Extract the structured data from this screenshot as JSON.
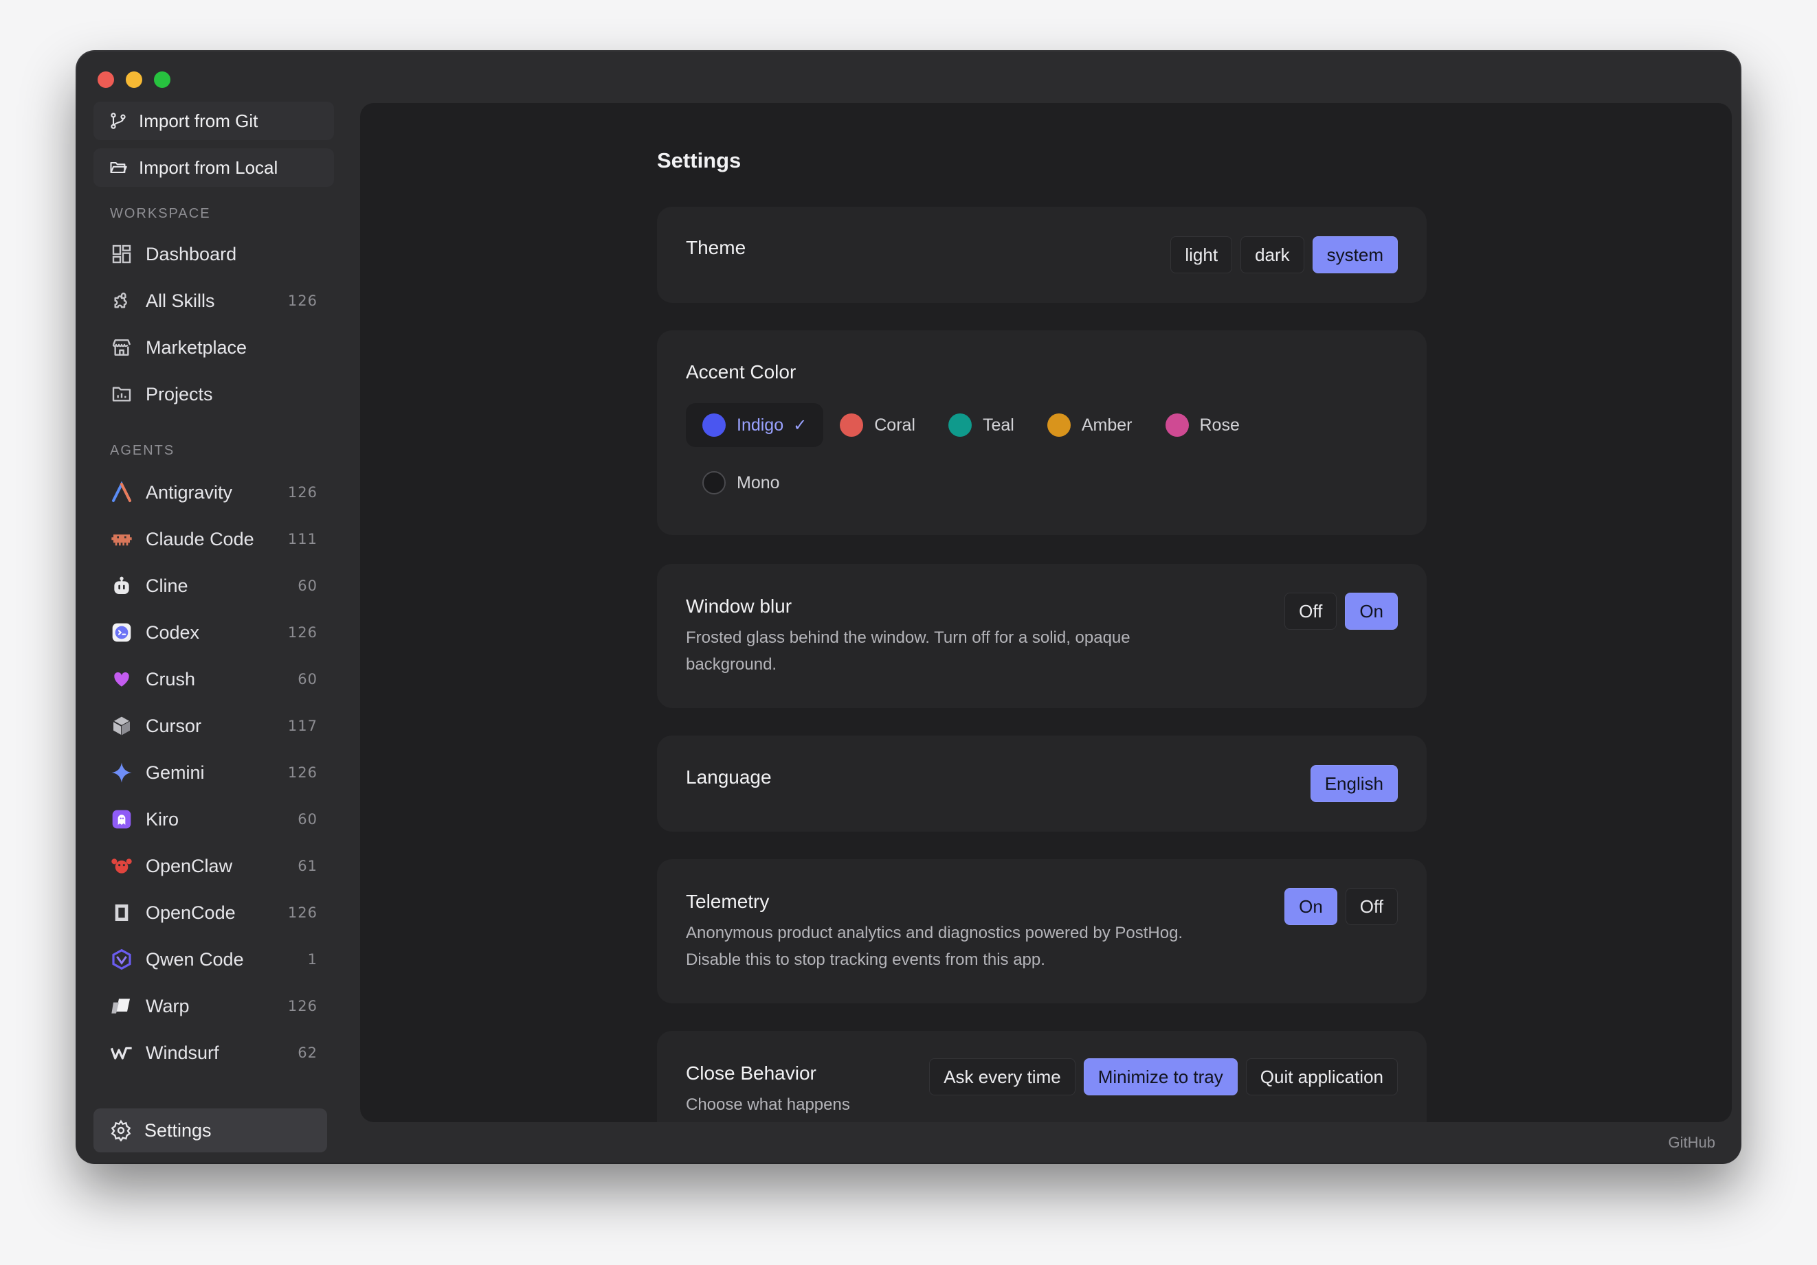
{
  "sidebar": {
    "import_git": "Import from Git",
    "import_local": "Import from Local",
    "workspace_label": "WORKSPACE",
    "workspace": [
      {
        "label": "Dashboard",
        "count": ""
      },
      {
        "label": "All Skills",
        "count": "126"
      },
      {
        "label": "Marketplace",
        "count": ""
      },
      {
        "label": "Projects",
        "count": ""
      }
    ],
    "agents_label": "AGENTS",
    "agents": [
      {
        "label": "Antigravity",
        "count": "126"
      },
      {
        "label": "Claude Code",
        "count": "111"
      },
      {
        "label": "Cline",
        "count": "60"
      },
      {
        "label": "Codex",
        "count": "126"
      },
      {
        "label": "Crush",
        "count": "60"
      },
      {
        "label": "Cursor",
        "count": "117"
      },
      {
        "label": "Gemini",
        "count": "126"
      },
      {
        "label": "Kiro",
        "count": "60"
      },
      {
        "label": "OpenClaw",
        "count": "61"
      },
      {
        "label": "OpenCode",
        "count": "126"
      },
      {
        "label": "Qwen Code",
        "count": "1"
      },
      {
        "label": "Warp",
        "count": "126"
      },
      {
        "label": "Windsurf",
        "count": "62"
      }
    ],
    "settings": "Settings"
  },
  "main": {
    "title": "Settings",
    "theme": {
      "title": "Theme",
      "options": [
        "light",
        "dark",
        "system"
      ],
      "selected": "system"
    },
    "accent": {
      "title": "Accent Color",
      "selected": "Indigo",
      "colors": [
        {
          "name": "Indigo",
          "color": "#4a56f0"
        },
        {
          "name": "Coral",
          "color": "#e05a52"
        },
        {
          "name": "Teal",
          "color": "#0f9a8c"
        },
        {
          "name": "Amber",
          "color": "#d9941c"
        },
        {
          "name": "Rose",
          "color": "#cf4a93"
        },
        {
          "name": "Mono",
          "color": "#1a1a1c"
        }
      ]
    },
    "blur": {
      "title": "Window blur",
      "desc": "Frosted glass behind the window. Turn off for a solid, opaque background.",
      "options": [
        "Off",
        "On"
      ],
      "selected": "On"
    },
    "language": {
      "title": "Language",
      "value": "English"
    },
    "telemetry": {
      "title": "Telemetry",
      "desc": "Anonymous product analytics and diagnostics powered by PostHog. Disable this to stop tracking events from this app.",
      "options": [
        "On",
        "Off"
      ],
      "selected": "On"
    },
    "close": {
      "title": "Close Behavior",
      "desc": "Choose what happens",
      "options": [
        "Ask every time",
        "Minimize to tray",
        "Quit application"
      ],
      "selected": "Minimize to tray"
    }
  },
  "footer": {
    "github": "GitHub"
  },
  "colors": {
    "accent": "#818cf8",
    "window_bg": "#2c2c2e",
    "main_bg": "#1f1f21",
    "card_bg": "#262628"
  }
}
